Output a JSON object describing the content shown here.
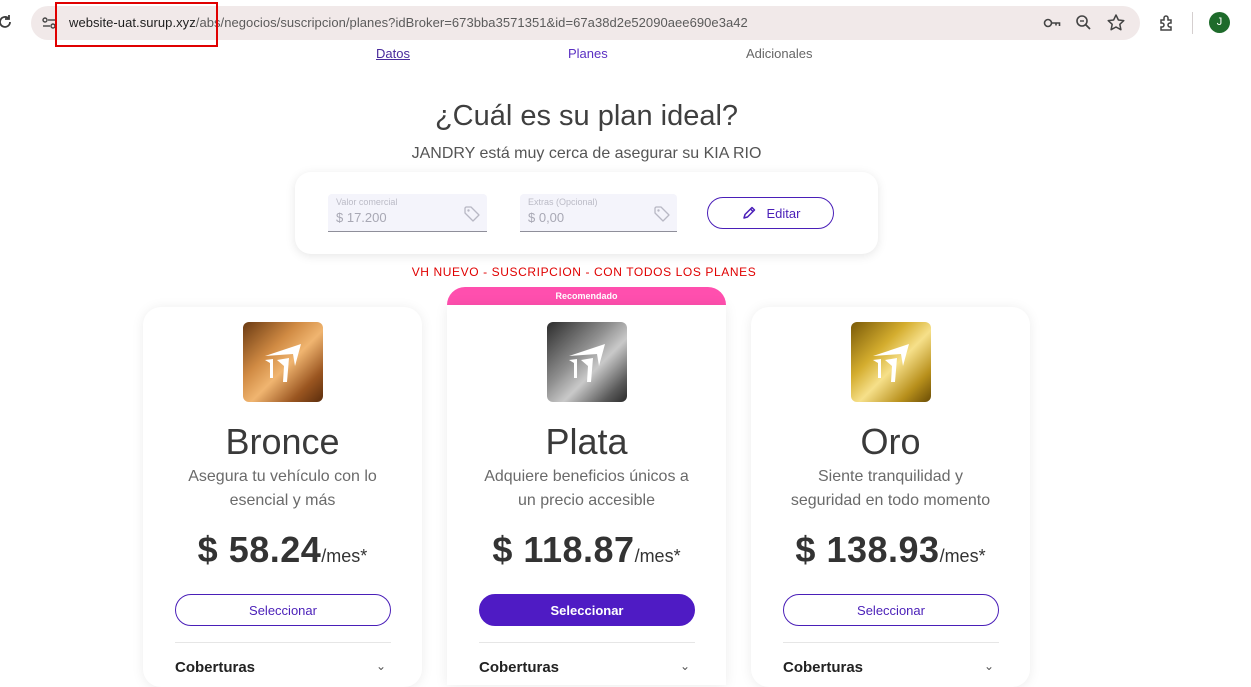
{
  "browser": {
    "url_host": "website-uat.surup.xyz",
    "url_path": "/abs/negocios/suscripcion/planes?idBroker=673bba3571351&id=67a38d2e52090aee690e3a42",
    "avatar_initial": "J",
    "icons": [
      "reload-icon",
      "site-info-icon",
      "password-key-icon",
      "zoom-icon",
      "bookmark-star-icon",
      "extensions-icon"
    ]
  },
  "steps": {
    "datos": "Datos",
    "planes": "Planes",
    "adicionales": "Adicionales"
  },
  "header": {
    "title": "¿Cuál es su plan ideal?",
    "subtitle": "JANDRY está muy cerca de asegurar su KIA RIO"
  },
  "valuation": {
    "valor_label": "Valor comercial",
    "valor_value": "$ 17.200",
    "extras_label": "Extras (Opcional)",
    "extras_value": "$ 0,00",
    "edit_label": "Editar"
  },
  "product_note": "VH NUEVO - SUSCRIPCION - CON TODOS LOS PLANES",
  "recommended_label": "Recomendado",
  "plans": [
    {
      "name": "Bronce",
      "description": "Asegura tu vehículo con lo esencial y más",
      "price": "$ 58.24",
      "unit": "/mes*",
      "button": "Seleccionar",
      "coverage_label": "Coberturas"
    },
    {
      "name": "Plata",
      "description": "Adquiere beneficios únicos a un precio accesible",
      "price": "$ 118.87",
      "unit": "/mes*",
      "button": "Seleccionar",
      "coverage_label": "Coberturas"
    },
    {
      "name": "Oro",
      "description": "Siente tranquilidad y seguridad en todo momento",
      "price": "$ 138.93",
      "unit": "/mes*",
      "button": "Seleccionar",
      "coverage_label": "Coberturas"
    }
  ],
  "colors": {
    "primary": "#4f1bc4",
    "recommended": "#ff4fae",
    "annotation": "#e00000"
  }
}
